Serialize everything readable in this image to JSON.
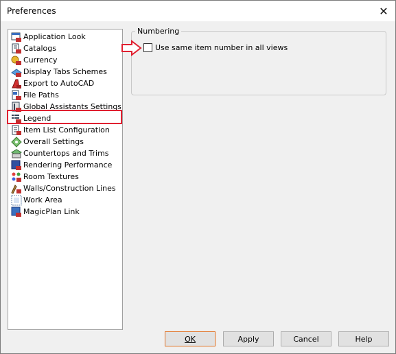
{
  "window": {
    "title": "Preferences",
    "close_glyph": "✕"
  },
  "tree": {
    "items": [
      {
        "label": "Application Look",
        "icon": "application-look-icon"
      },
      {
        "label": "Catalogs",
        "icon": "catalogs-icon"
      },
      {
        "label": "Currency",
        "icon": "currency-icon"
      },
      {
        "label": "Display Tabs Schemes",
        "icon": "display-tabs-icon"
      },
      {
        "label": "Export to AutoCAD",
        "icon": "autocad-icon"
      },
      {
        "label": "File Paths",
        "icon": "file-paths-icon"
      },
      {
        "label": "Global Assistants Settings",
        "icon": "assistants-icon"
      },
      {
        "label": "Legend",
        "icon": "legend-icon"
      },
      {
        "label": "Item List Configuration",
        "icon": "item-list-icon"
      },
      {
        "label": "Overall Settings",
        "icon": "overall-settings-icon"
      },
      {
        "label": "Countertops and Trims",
        "icon": "countertops-icon"
      },
      {
        "label": "Rendering Performance",
        "icon": "rendering-icon"
      },
      {
        "label": "Room Textures",
        "icon": "room-textures-icon"
      },
      {
        "label": "Walls/Construction Lines",
        "icon": "walls-icon"
      },
      {
        "label": "Work Area",
        "icon": "work-area-icon"
      },
      {
        "label": "MagicPlan Link",
        "icon": "magicplan-icon"
      }
    ],
    "selected": "Legend"
  },
  "numbering": {
    "legend": "Numbering",
    "checkbox_label": "Use same item number in all views",
    "checked": false
  },
  "buttons": {
    "ok": "OK",
    "apply": "Apply",
    "cancel": "Cancel",
    "help": "Help"
  },
  "colors": {
    "annotation_red": "#e02030",
    "default_button_border": "#e07020"
  }
}
